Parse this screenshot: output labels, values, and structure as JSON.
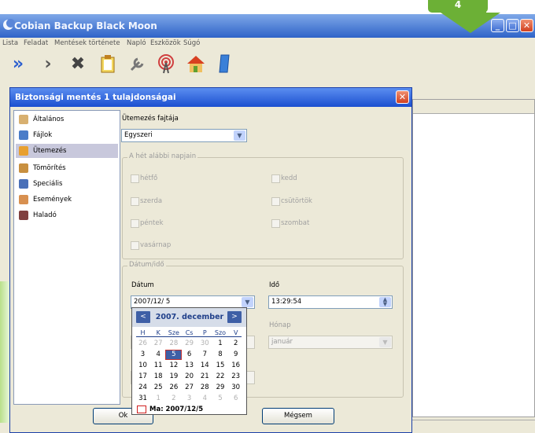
{
  "callout": {
    "number": "4"
  },
  "app": {
    "title": "Cobian Backup Black Moon",
    "menu": [
      "Lista",
      "Feladat",
      "Mentések története",
      "Napló",
      "Eszközök",
      "Súgó"
    ]
  },
  "toolbar": {
    "icons": [
      "run-all-icon",
      "run-icon",
      "cancel-icon",
      "clipboard-icon",
      "tools-icon",
      "antenna-icon",
      "home-icon",
      "info-icon"
    ]
  },
  "dialog": {
    "title": "Biztonsági mentés 1 tulajdonságai",
    "nav": [
      {
        "label": "Általános",
        "icon": "general-icon",
        "color": "#d8b070"
      },
      {
        "label": "Fájlok",
        "icon": "files-icon",
        "color": "#4a7cc8"
      },
      {
        "label": "Ütemezés",
        "icon": "schedule-icon",
        "color": "#e8a030"
      },
      {
        "label": "Tömörítés",
        "icon": "compress-icon",
        "color": "#c89040"
      },
      {
        "label": "Speciális",
        "icon": "special-icon",
        "color": "#4a70b8"
      },
      {
        "label": "Események",
        "icon": "events-icon",
        "color": "#d89050"
      },
      {
        "label": "Haladó",
        "icon": "advanced-icon",
        "color": "#804040"
      }
    ],
    "selected_nav": "Ütemezés",
    "schedule_type_label": "Ütemezés fajtája",
    "schedule_type_value": "Egyszeri",
    "weekdays_group": "A hét alábbi napjain",
    "weekdays": {
      "mon": "hétfő",
      "tue": "kedd",
      "wed": "szerda",
      "thu": "csütörtök",
      "fri": "péntek",
      "sat": "szombat",
      "sun": "vasárnap"
    },
    "datetime_group": "Dátum/idő",
    "date_label": "Dátum",
    "date_value": "2007/12/ 5",
    "time_label": "Idő",
    "time_value": "13:29:54",
    "month_label": "Hónap",
    "month_value": "január",
    "ok_label": "Ok",
    "cancel_label": "Mégsem"
  },
  "calendar": {
    "month_title": "2007. december",
    "dow": [
      "H",
      "K",
      "Sze",
      "Cs",
      "P",
      "Szo",
      "V"
    ],
    "weeks": [
      [
        "26",
        "27",
        "28",
        "29",
        "30",
        "1",
        "2"
      ],
      [
        "3",
        "4",
        "5",
        "6",
        "7",
        "8",
        "9"
      ],
      [
        "10",
        "11",
        "12",
        "13",
        "14",
        "15",
        "16"
      ],
      [
        "17",
        "18",
        "19",
        "20",
        "21",
        "22",
        "23"
      ],
      [
        "24",
        "25",
        "26",
        "27",
        "28",
        "29",
        "30"
      ],
      [
        "31",
        "1",
        "2",
        "3",
        "4",
        "5",
        "6"
      ]
    ],
    "selected_day": "5",
    "today_label": "Ma: 2007/12/5"
  }
}
